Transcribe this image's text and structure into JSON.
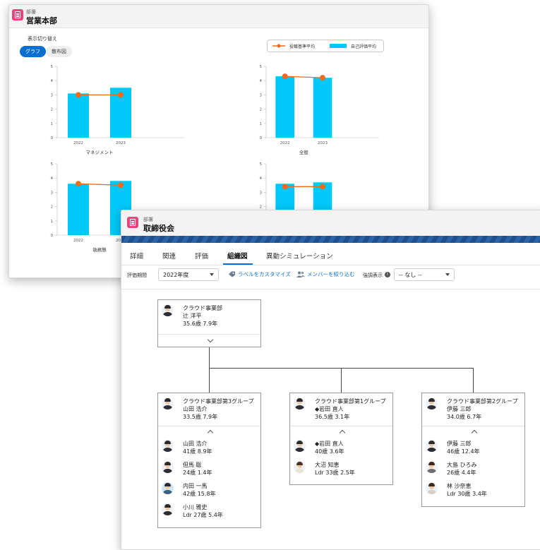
{
  "back_window": {
    "object_type": "部署",
    "title": "営業本部",
    "toggle_label": "表示切り替え",
    "toggle_options": [
      "グラフ",
      "散布図"
    ],
    "toggle_selected": "グラフ",
    "legend": {
      "line_label": "役職基準平均",
      "bar_label": "自己評価平均"
    },
    "colors": {
      "bar": "#00C8F8",
      "line": "#F26B1D",
      "toggle_active": "#0B6FCF"
    }
  },
  "chart_data": [
    {
      "type": "bar",
      "title": "マネジメント",
      "categories": [
        "2022",
        "2023"
      ],
      "series": [
        {
          "name": "自己評価平均",
          "values": [
            3.1,
            3.5
          ]
        },
        {
          "name": "役職基準平均",
          "values": [
            3.0,
            3.0
          ]
        }
      ],
      "ylim": [
        0,
        5
      ],
      "yticks": [
        0,
        1,
        2,
        3,
        4,
        5
      ]
    },
    {
      "type": "bar",
      "title": "全般",
      "categories": [
        "2022",
        "2023"
      ],
      "series": [
        {
          "name": "自己評価平均",
          "values": [
            4.3,
            4.2
          ]
        },
        {
          "name": "役職基準平均",
          "values": [
            4.3,
            4.2
          ]
        }
      ],
      "ylim": [
        0,
        5
      ],
      "yticks": [
        0,
        1,
        2,
        3,
        4,
        5
      ]
    },
    {
      "type": "bar",
      "title": "執務態",
      "categories": [
        "2022",
        "2023"
      ],
      "series": [
        {
          "name": "自己評価平均",
          "values": [
            3.6,
            3.8
          ]
        },
        {
          "name": "役職基準平均",
          "values": [
            3.6,
            3.5
          ]
        }
      ],
      "ylim": [
        0,
        5
      ],
      "yticks": [
        0,
        1,
        2,
        3,
        4,
        5
      ]
    },
    {
      "type": "bar",
      "title": "",
      "categories": [
        "2022",
        "2023"
      ],
      "series": [
        {
          "name": "自己評価平均",
          "values": [
            3.6,
            3.7
          ]
        },
        {
          "name": "役職基準平均",
          "values": [
            3.4,
            3.4
          ]
        }
      ],
      "ylim": [
        0,
        5
      ],
      "yticks": [
        0,
        1,
        2,
        3,
        4,
        5
      ]
    }
  ],
  "front_window": {
    "object_type": "部署",
    "title": "取締役会",
    "tabs": [
      "詳細",
      "関連",
      "評価",
      "組織図",
      "異動シミュレーション"
    ],
    "active_tab": "組織図",
    "toolbar": {
      "period_label": "評価期間",
      "period_value": "2022年度",
      "customize_label": "ラベルをカスタマイズ",
      "filter_label": "メンバーを絞り込む",
      "highlight_label": "強調表示",
      "highlight_value": "-- なし --"
    },
    "root": {
      "dept": "クラウド事業部",
      "name": "辻 洋平",
      "stats": "35.6歳 7.9年"
    },
    "groups": [
      {
        "dept": "クラウド事業部第3グループ",
        "leader": "山田 浩介",
        "stats": "33.5歳 7.9年",
        "members": [
          {
            "name": "山田 浩介",
            "stats": "41歳 8.9年"
          },
          {
            "name": "但馬 聡",
            "stats": "24歳 1.4年"
          },
          {
            "name": "内田 一馬",
            "stats": "42歳 15.8年"
          },
          {
            "name": "小川 雅史",
            "stats": "Ldr 27歳 5.4年"
          }
        ]
      },
      {
        "dept": "クラウド事業部第1グループ",
        "leader": "◆岩田 直人",
        "stats": "36.5歳 3.1年",
        "members": [
          {
            "name": "◆岩田 直人",
            "stats": "40歳 3.6年"
          },
          {
            "name": "大沼 知恵",
            "stats": "Ldr 33歳 2.5年"
          }
        ]
      },
      {
        "dept": "クラウド事業部第2グループ",
        "leader": "伊藤 三郎",
        "stats": "34.0歳 6.7年",
        "members": [
          {
            "name": "伊藤 三郎",
            "stats": "46歳 12.4年"
          },
          {
            "name": "大島 ひろみ",
            "stats": "26歳 4.4年"
          },
          {
            "name": "林 沙奈恵",
            "stats": "Ldr 30歳 3.4年"
          }
        ]
      }
    ]
  }
}
